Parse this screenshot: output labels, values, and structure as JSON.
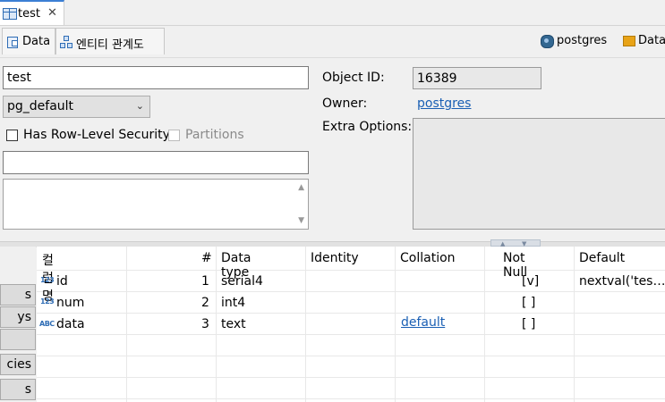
{
  "editor_tab": {
    "title": "test",
    "close": "✕",
    "icon": "table-icon"
  },
  "subtabs": [
    {
      "label": "Data",
      "icon": "data-icon"
    },
    {
      "label": "엔티티 관계도",
      "icon": "er-diagram-icon"
    }
  ],
  "toolbar_right": {
    "connection": "postgres",
    "database": "Data"
  },
  "form": {
    "name": "test",
    "tablespace": "pg_default",
    "row_level_security_label": "Has Row-Level Security",
    "partitions_label": "Partitions",
    "object_id_label": "Object ID:",
    "object_id": "16389",
    "owner_label": "Owner:",
    "owner": "postgres",
    "extra_options_label": "Extra Options:"
  },
  "side_tabs": [
    "s",
    "ys",
    "",
    "cies",
    "s"
  ],
  "grid": {
    "headers": [
      "컬럼명",
      "#",
      "Data type",
      "Identity",
      "Collation",
      "Not Null",
      "Default"
    ],
    "rows": [
      {
        "type_badge": "123",
        "name": "id",
        "num": "1",
        "data_type": "serial4",
        "identity": "",
        "collation": "",
        "not_null": "[v]",
        "default": "nextval('tes…"
      },
      {
        "type_badge": "123",
        "name": "num",
        "num": "2",
        "data_type": "int4",
        "identity": "",
        "collation": "",
        "not_null": "[ ]",
        "default": ""
      },
      {
        "type_badge": "ABC",
        "name": "data",
        "num": "3",
        "data_type": "text",
        "identity": "",
        "collation": "default",
        "not_null": "[ ]",
        "default": ""
      }
    ]
  },
  "colors": {
    "accent": "#3c7fd4",
    "link": "#1a5fb4"
  }
}
